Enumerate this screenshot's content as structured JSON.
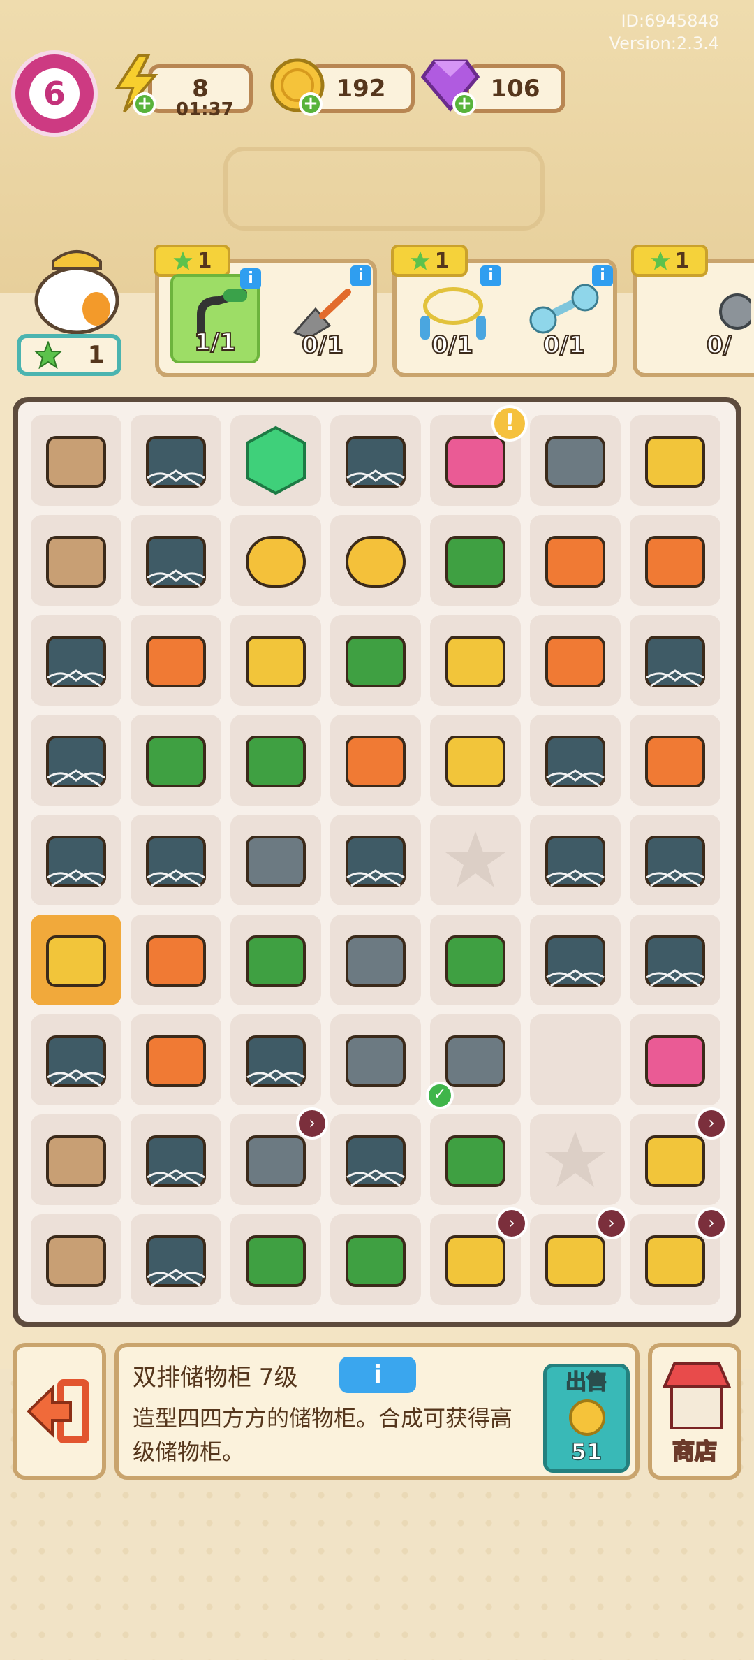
{
  "account": {
    "id": "ID:6945848",
    "version": "Version:2.3.4"
  },
  "resources": {
    "level": "6",
    "energy": "8",
    "energy_timer": "01:37",
    "coins": "192",
    "gems": "106",
    "stars": "1"
  },
  "orders": [
    {
      "reward": "1",
      "items": [
        {
          "icon": "wrench-handle-icon",
          "count": "1/1",
          "done": true
        },
        {
          "icon": "trowel-icon",
          "count": "0/1",
          "done": false
        }
      ]
    },
    {
      "reward": "1",
      "items": [
        {
          "icon": "jump-rope-icon",
          "count": "0/1",
          "done": false
        },
        {
          "icon": "dumbbell-icon",
          "count": "0/1",
          "done": false
        }
      ]
    },
    {
      "reward": "1",
      "items": [
        {
          "icon": "gray-item-icon",
          "count": "0/",
          "done": false
        }
      ]
    }
  ],
  "board": [
    [
      "cardboard-box-icon",
      "webbed-toolbox-icon",
      "infinity-gem-icon",
      "webbed-sock-icon",
      "pink-backpack-icon",
      "weight-plate-icon",
      "yellow-cart-icon"
    ],
    [
      "cardboard-box-icon",
      "webbed-chip-icon",
      "coin-pile-large-icon",
      "coin-pile-icon",
      "seed-bag-icon",
      "wallet-icon",
      "pencil-icon"
    ],
    [
      "webbed-toolbox-icon",
      "orange-cooler-icon",
      "basket-dumbbell-icon",
      "green-case-icon",
      "wicker-basket-icon",
      "apple-core-icon",
      "webbed-rope-icon"
    ],
    [
      "webbed-gloves-icon",
      "potted-plant-icon",
      "screwdriver-icon",
      "utility-knife-icon",
      "work-glove-icon",
      "webbed-chip-icon",
      "clay-pot-icon"
    ],
    [
      "webbed-crate-icon",
      "webbed-gloves-icon",
      "adjustable-wrench-icon",
      "webbed-sock-icon",
      "empty-star-slot-icon",
      "webbed-board-icon",
      "webbed-crate-icon"
    ],
    [
      "storage-cabinet-icon",
      "tape-measure-icon",
      "megaphone-icon",
      "newspaper-icon",
      "green-clip-icon",
      "webbed-sock-icon",
      "webbed-board-icon"
    ],
    [
      "webbed-chip-icon",
      "clay-stone-icon",
      "webbed-yarn-icon",
      "toolbox-open-icon",
      "wrench-handle-icon",
      "empty-slot-icon",
      "paint-can-icon"
    ],
    [
      "cardboard-box-icon",
      "webbed-crate-icon",
      "robot-vacuum-icon",
      "webbed-crate-icon",
      "green-glove-icon",
      "empty-star-slot-icon",
      "yellow-box-icon"
    ],
    [
      "cardboard-box-icon",
      "webbed-chip-icon",
      "green-kit-icon",
      "green-kit-alt-icon",
      "shopping-cart-icon",
      "bucket-icon",
      "picnic-basket-icon"
    ]
  ],
  "selected_item": {
    "title": "双排储物柜 7级",
    "description": "造型四四方方的储物柜。合成可获得高级储物柜。",
    "info_button": "i",
    "sell_label": "出售",
    "sell_price": "51"
  },
  "shop": {
    "label": "商店"
  },
  "colors": {
    "accent": "#39b9b7",
    "frame": "#c9a46d",
    "board_border": "#5d4b3d",
    "level": "#cd3a82"
  }
}
